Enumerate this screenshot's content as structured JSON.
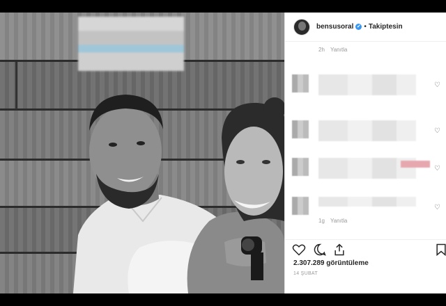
{
  "post": {
    "username": "bensusoral",
    "verified_badge": "✔",
    "separator": "•",
    "follow_status": "Takiptesin",
    "top_time": "2h",
    "top_reply": "Yanıtla",
    "comment_like_icon": "heart-outline-icon",
    "bottom_time": "1g",
    "bottom_reply": "Yanıtla",
    "views": "2.307.289 görüntüleme",
    "date": "14 ŞUBAT"
  },
  "colors": {
    "verified": "#3897f0",
    "text": "#262626",
    "muted": "#999999",
    "blur_accent": "#e6a8ae"
  },
  "icons": {
    "like": "heart-outline-icon",
    "comment": "speech-bubble-icon",
    "share": "share-icon",
    "save": "bookmark-icon"
  }
}
